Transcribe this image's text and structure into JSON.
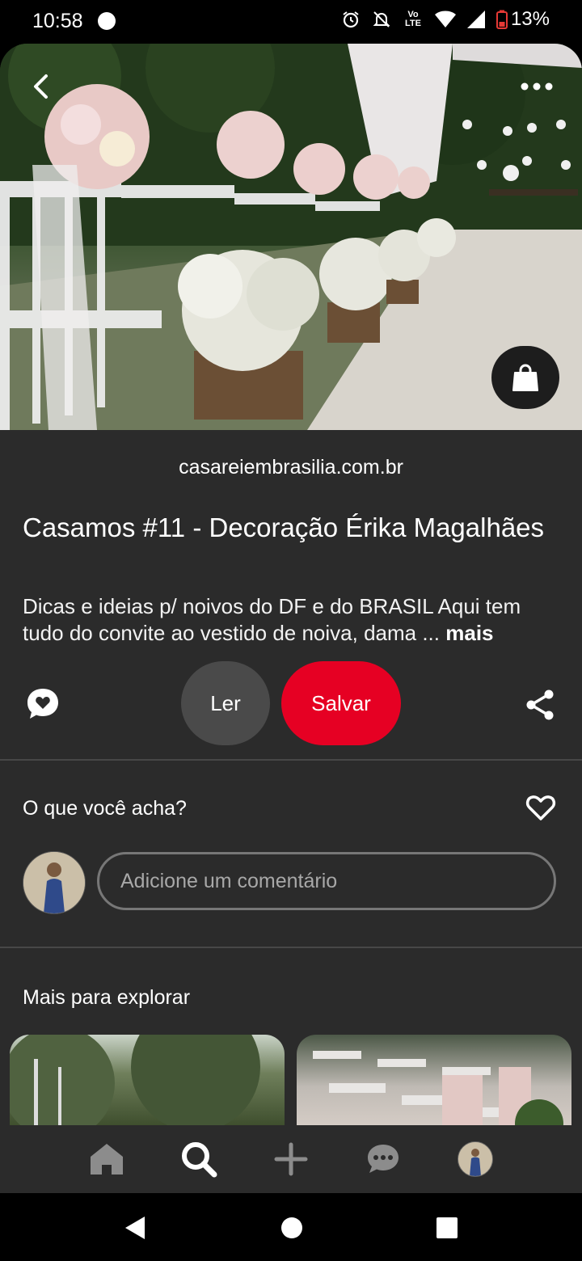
{
  "status_bar": {
    "time": "10:58",
    "battery": "13%",
    "network_label": "Vo LTE",
    "icons": [
      "alarm-icon",
      "mute-icon",
      "volte-icon",
      "wifi-icon",
      "signal-icon",
      "battery-icon"
    ]
  },
  "pin": {
    "source": "casareiembrasilia.com.br",
    "title": "Casamos #11 - Decoração Érika Magalhães",
    "description": "Dicas e ideias p/ noivos do DF e do BRASIL Aqui tem tudo do convite ao vestido de noiva, dama ...",
    "more_label": "mais"
  },
  "actions": {
    "read_label": "Ler",
    "save_label": "Salvar"
  },
  "comments": {
    "heading": "O que você acha?",
    "placeholder": "Adicione um comentário"
  },
  "explore": {
    "heading": "Mais para explorar"
  },
  "nav": {
    "items": [
      "home-icon",
      "search-icon",
      "plus-icon",
      "chat-icon",
      "profile-avatar"
    ]
  },
  "colors": {
    "accent_red": "#e60023",
    "surface": "#2b2b2b",
    "read_button": "#4a4a4a"
  }
}
